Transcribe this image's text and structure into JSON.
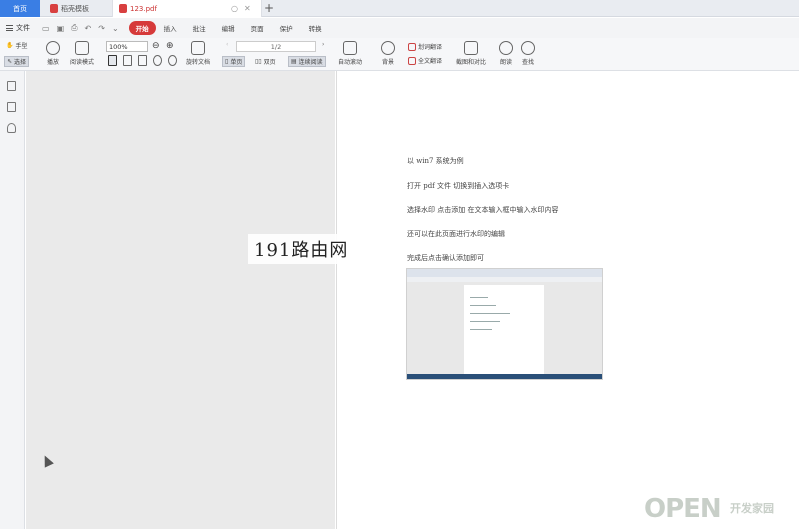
{
  "tabs": [
    {
      "label": "首页"
    },
    {
      "label": "稻壳模板"
    },
    {
      "label": "123.pdf"
    }
  ],
  "new_tab": "+",
  "menu": {
    "file_label": "文件",
    "items": [
      "开始",
      "插入",
      "批注",
      "编辑",
      "页面",
      "保护",
      "转换"
    ],
    "active": "开始"
  },
  "toolbar": {
    "hand": "手型",
    "select": "选择",
    "play": "播放",
    "read_mode": "阅读模式",
    "zoom": "100%",
    "rotate_doc": "旋转文档",
    "page_indicator": "1/2",
    "single_page": "单页",
    "double_page": "双页",
    "continuous": "连续阅读",
    "auto_scroll": "自动滚动",
    "background": "背景",
    "word_translate": "划词翻译",
    "full_translate": "全文翻译",
    "screenshot": "截图和对比",
    "read_aloud": "朗读",
    "find": "查找"
  },
  "document": {
    "lines": [
      "以 win7 系统为例",
      "打开 pdf 文件    切换到插入选项卡",
      "选择水印      点击添加    在文本输入框中输入水印内容",
      "还可以在此页面进行水印的编辑",
      "完成后点击确认添加即可"
    ]
  },
  "watermark": "191路由网",
  "brand": {
    "logo": "OPEN",
    "sub": "开发家园"
  },
  "colors": {
    "accent_blue": "#3a7ee4",
    "active_red": "#d63a3a",
    "canvas_gray": "#eaeaea"
  }
}
